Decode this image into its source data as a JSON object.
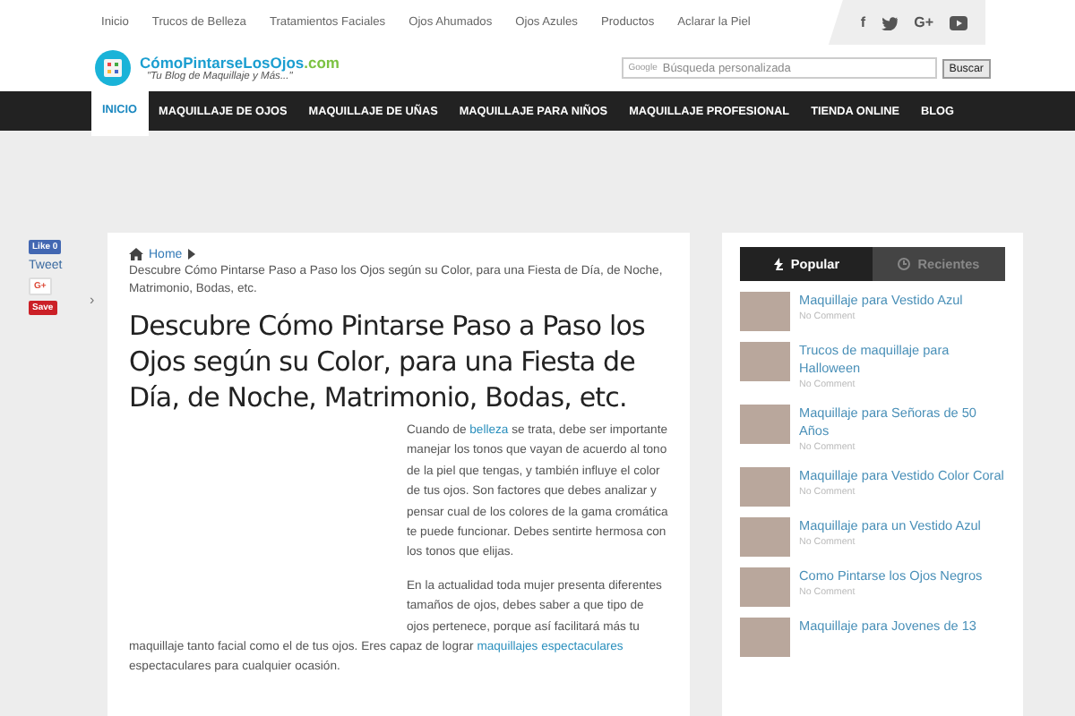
{
  "top_menu": [
    {
      "label": "Inicio"
    },
    {
      "label": "Trucos de Belleza"
    },
    {
      "label": "Tratamientos Faciales"
    },
    {
      "label": "Ojos Ahumados"
    },
    {
      "label": "Ojos Azules"
    },
    {
      "label": "Productos"
    },
    {
      "label": "Aclarar la Piel"
    }
  ],
  "social": [
    {
      "kind": "facebook",
      "glyph": "f"
    },
    {
      "kind": "twitter"
    },
    {
      "kind": "googleplus",
      "glyph": "G+"
    },
    {
      "kind": "youtube"
    }
  ],
  "logo": {
    "name": "CómoPintarseLosOjos",
    "suffix": ".com",
    "slogan": "\"Tu Blog de Maquillaje y Más...\""
  },
  "search": {
    "brand": "Google",
    "placeholder": "Búsqueda personalizada",
    "button": "Buscar"
  },
  "nav": [
    {
      "label": "INICIO",
      "selected": true
    },
    {
      "label": "MAQUILLAJE DE OJOS",
      "selected": false
    },
    {
      "label": "MAQUILLAJE DE UÑAS",
      "selected": false
    },
    {
      "label": "MAQUILLAJE PARA NIÑOS",
      "selected": false
    },
    {
      "label": "MAQUILLAJE PROFESIONAL",
      "selected": false
    },
    {
      "label": "TIENDA ONLINE",
      "selected": false
    },
    {
      "label": "BLOG",
      "selected": false
    }
  ],
  "share": [
    {
      "kind": "like",
      "label": "Like 0"
    },
    {
      "kind": "tweet",
      "label": "Tweet"
    },
    {
      "kind": "gplus",
      "label": "G+"
    },
    {
      "kind": "save",
      "label": "Save"
    }
  ],
  "share_toggle": "›",
  "breadcrumb": {
    "home": "Home",
    "current": "Descubre Cómo Pintarse Paso a Paso los Ojos según su Color, para una Fiesta de Día, de Noche, Matrimonio, Bodas, etc."
  },
  "article": {
    "title": "Descubre Cómo Pintarse Paso a Paso los Ojos según su Color, para una Fiesta de Día, de Noche, Matrimonio, Bodas, etc.",
    "paragraphs": [
      [
        {
          "kind": "text",
          "text": "Cuando de "
        },
        {
          "kind": "link",
          "text": "belleza"
        },
        {
          "kind": "text",
          "text": " se trata, debe ser importante manejar los tonos que vayan de acuerdo al tono de la piel que tengas, y también influye el color de tus ojos. Son factores que debes analizar y pensar cual de los colores de la gama cromática te puede funcionar. Debes sentirte hermosa con los tonos que elijas."
        }
      ],
      [
        {
          "kind": "text",
          "text": "En la actualidad toda mujer presenta diferentes tamaños de ojos, debes saber a que tipo de ojos pertenece, porque así facilitará más tu maquillaje tanto facial como el de tus ojos. Eres capaz de lograr "
        },
        {
          "kind": "link",
          "text": "maquillajes espectaculares"
        },
        {
          "kind": "text",
          "text": " espectaculares para cualquier ocasión."
        }
      ]
    ]
  },
  "sidebar": {
    "tabs": [
      {
        "label": "Popular",
        "selected": true
      },
      {
        "label": "Recientes",
        "selected": false
      }
    ],
    "posts": [
      {
        "title": "Maquillaje para Vestido Azul",
        "meta": "No Comment"
      },
      {
        "title": "Trucos de maquillaje para Halloween",
        "meta": "No Comment"
      },
      {
        "title": "Maquillaje para Señoras de 50 Años",
        "meta": "No Comment"
      },
      {
        "title": "Maquillaje para Vestido Color Coral",
        "meta": "No Comment"
      },
      {
        "title": "Maquillaje para un Vestido Azul",
        "meta": "No Comment"
      },
      {
        "title": "Como Pintarse los Ojos Negros",
        "meta": "No Comment"
      },
      {
        "title": "Maquillaje para Jovenes de 13"
      }
    ]
  }
}
